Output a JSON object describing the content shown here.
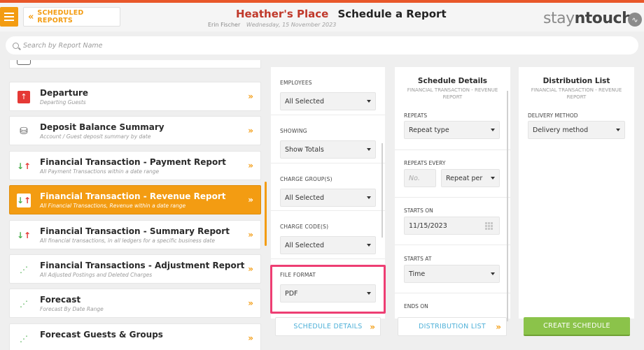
{
  "header": {
    "back_label": "SCHEDULED REPORTS",
    "hotel_name": "Heather's Place",
    "page_title": "Schedule a Report",
    "user_name": "Erin Fischer",
    "date": "Wednesday, 15 November 2023",
    "logo_text_1": "stay",
    "logo_text_2": "n",
    "logo_text_3": "touch"
  },
  "search": {
    "placeholder": "Search by Report Name"
  },
  "reports": [
    {
      "name": "Departure",
      "desc": "Departing Guests",
      "icon": "departure-icon"
    },
    {
      "name": "Deposit Balance Summary",
      "desc": "Account / Guest deposit summary by date",
      "icon": "coins-icon"
    },
    {
      "name": "Financial Transaction - Payment Report",
      "desc": "All Payment Transactions within a date range",
      "icon": "transfer-arrows-icon"
    },
    {
      "name": "Financial Transaction - Revenue Report",
      "desc": "All Financial Transactions, Revenue within a date range",
      "icon": "transfer-arrows-icon",
      "active": true
    },
    {
      "name": "Financial Transaction - Summary Report",
      "desc": "All financial transactions, in all ledgers for a specific business date",
      "icon": "transfer-arrows-icon"
    },
    {
      "name": "Financial Transactions - Adjustment Report",
      "desc": "All Adjusted Postings and Deleted Charges",
      "icon": "trend-chart-icon"
    },
    {
      "name": "Forecast",
      "desc": "Forecast By Date Range",
      "icon": "trend-chart-icon"
    },
    {
      "name": "Forecast Guests & Groups",
      "desc": "",
      "icon": "trend-chart-icon"
    }
  ],
  "filters": {
    "employees": {
      "label": "EMPLOYEES",
      "value": "All Selected"
    },
    "showing": {
      "label": "SHOWING",
      "value": "Show Totals"
    },
    "charge_groups": {
      "label": "CHARGE GROUP(S)",
      "value": "All Selected"
    },
    "charge_codes": {
      "label": "CHARGE CODE(S)",
      "value": "All Selected"
    },
    "file_format": {
      "label": "FILE FORMAT",
      "value": "PDF"
    }
  },
  "schedule": {
    "title": "Schedule Details",
    "subtitle": "FINANCIAL TRANSACTION - REVENUE REPORT",
    "repeats_label": "REPEATS",
    "repeats_value": "Repeat type",
    "repeats_every_label": "REPEATS EVERY",
    "repeats_every_placeholder": "No.",
    "repeat_per_value": "Repeat per",
    "starts_on_label": "STARTS ON",
    "starts_on_value": "11/15/2023",
    "starts_at_label": "STARTS AT",
    "starts_at_value": "Time",
    "ends_on_label": "ENDS ON"
  },
  "distribution": {
    "title": "Distribution List",
    "subtitle": "FINANCIAL TRANSACTION - REVENUE REPORT",
    "delivery_label": "DELIVERY METHOD",
    "delivery_value": "Delivery method"
  },
  "footer": {
    "schedule_details_btn": "SCHEDULE DETAILS",
    "distribution_list_btn": "DISTRIBUTION LIST",
    "create_btn": "CREATE SCHEDULE"
  },
  "colors": {
    "accent": "#f39c12",
    "hotel": "#c0392b",
    "create": "#8bc34a",
    "highlight": "#ee3e73",
    "link": "#4eb0d8"
  }
}
